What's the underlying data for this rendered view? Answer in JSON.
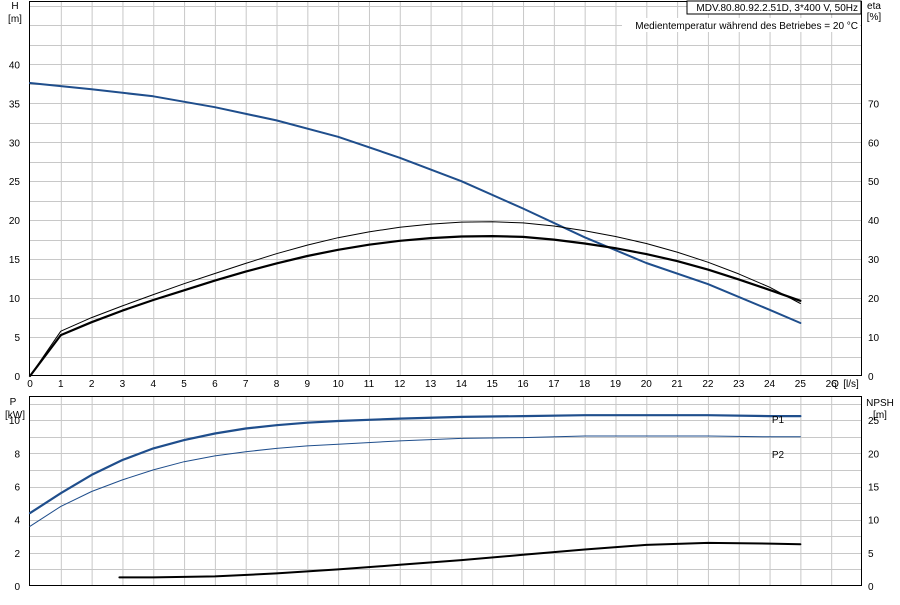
{
  "header": {
    "model": "MDV.80.80.92.2.51D, 3*400 V, 50Hz",
    "note": "Medientemperatur während des Betriebes = 20 °C"
  },
  "chart_data": [
    {
      "type": "line",
      "panel": "top",
      "x_axis": {
        "label": "Q",
        "unit": "[l/s]",
        "range": [
          0,
          27
        ],
        "ticks": [
          0,
          1,
          2,
          3,
          4,
          5,
          6,
          7,
          8,
          9,
          10,
          11,
          12,
          13,
          14,
          15,
          16,
          17,
          18,
          19,
          20,
          21,
          22,
          23,
          24,
          25,
          26
        ]
      },
      "y_left": {
        "label": "H",
        "unit": "[m]",
        "range": [
          0,
          48
        ],
        "ticks": [
          0,
          5,
          10,
          15,
          20,
          25,
          30,
          35,
          40
        ]
      },
      "y_right": {
        "label": "eta",
        "unit": "[%]",
        "range": [
          0,
          96
        ],
        "ticks": [
          0,
          10,
          20,
          30,
          40,
          50,
          60,
          70
        ]
      },
      "grid": true,
      "series": [
        {
          "axis": "left",
          "color": "#1f4e8c",
          "points": [
            [
              0,
              37.6
            ],
            [
              2,
              36.8
            ],
            [
              4,
              35.9
            ],
            [
              6,
              34.5
            ],
            [
              8,
              32.8
            ],
            [
              10,
              30.7
            ],
            [
              12,
              28.0
            ],
            [
              14,
              25.0
            ],
            [
              16,
              21.5
            ],
            [
              18,
              17.8
            ],
            [
              20,
              14.5
            ],
            [
              22,
              11.8
            ],
            [
              24,
              8.5
            ],
            [
              25,
              6.8
            ]
          ]
        },
        {
          "axis": "right",
          "color": "#000000",
          "points": [
            [
              0,
              0
            ],
            [
              1,
              10.5
            ],
            [
              2,
              13.8
            ],
            [
              3,
              16.8
            ],
            [
              4,
              19.5
            ],
            [
              5,
              22.0
            ],
            [
              6,
              24.5
            ],
            [
              7,
              26.8
            ],
            [
              8,
              28.9
            ],
            [
              9,
              30.8
            ],
            [
              10,
              32.4
            ],
            [
              11,
              33.7
            ],
            [
              12,
              34.7
            ],
            [
              13,
              35.4
            ],
            [
              14,
              35.8
            ],
            [
              15,
              35.9
            ],
            [
              16,
              35.7
            ],
            [
              17,
              35.0
            ],
            [
              18,
              34.0
            ],
            [
              19,
              32.8
            ],
            [
              20,
              31.3
            ],
            [
              21,
              29.5
            ],
            [
              22,
              27.3
            ],
            [
              23,
              24.8
            ],
            [
              24,
              22.1
            ],
            [
              25,
              19.3
            ]
          ]
        },
        {
          "axis": "right",
          "color": "#000000",
          "points": [
            [
              0,
              0
            ],
            [
              1,
              11.5
            ],
            [
              2,
              15.0
            ],
            [
              3,
              18.0
            ],
            [
              4,
              20.9
            ],
            [
              5,
              23.7
            ],
            [
              6,
              26.3
            ],
            [
              7,
              28.9
            ],
            [
              8,
              31.4
            ],
            [
              9,
              33.6
            ],
            [
              10,
              35.5
            ],
            [
              11,
              37.0
            ],
            [
              12,
              38.2
            ],
            [
              13,
              39.0
            ],
            [
              14,
              39.5
            ],
            [
              15,
              39.6
            ],
            [
              16,
              39.3
            ],
            [
              17,
              38.5
            ],
            [
              18,
              37.3
            ],
            [
              19,
              35.8
            ],
            [
              20,
              34.0
            ],
            [
              21,
              31.8
            ],
            [
              22,
              29.2
            ],
            [
              23,
              26.2
            ],
            [
              24,
              22.8
            ],
            [
              25,
              18.6
            ]
          ]
        }
      ]
    },
    {
      "type": "line",
      "panel": "bottom",
      "x_axis": {
        "range": [
          0,
          27
        ]
      },
      "y_left": {
        "label": "P",
        "unit": "[kW]",
        "range": [
          0,
          11.4
        ],
        "ticks": [
          0,
          2,
          4,
          6,
          8,
          10
        ]
      },
      "y_right": {
        "label": "NPSH",
        "unit": "[m]",
        "range": [
          0,
          28.5
        ],
        "ticks": [
          0,
          5,
          10,
          15,
          20,
          25
        ]
      },
      "grid": true,
      "series": [
        {
          "name": "P1",
          "axis": "left",
          "color": "#1f4e8c",
          "points": [
            [
              0,
              4.4
            ],
            [
              1,
              5.6
            ],
            [
              2,
              6.7
            ],
            [
              3,
              7.6
            ],
            [
              4,
              8.3
            ],
            [
              5,
              8.8
            ],
            [
              6,
              9.2
            ],
            [
              7,
              9.5
            ],
            [
              8,
              9.7
            ],
            [
              9,
              9.85
            ],
            [
              10,
              9.95
            ],
            [
              12,
              10.1
            ],
            [
              14,
              10.2
            ],
            [
              16,
              10.25
            ],
            [
              18,
              10.3
            ],
            [
              20,
              10.3
            ],
            [
              22,
              10.3
            ],
            [
              24,
              10.25
            ],
            [
              25,
              10.25
            ]
          ]
        },
        {
          "name": "P2",
          "axis": "left",
          "color": "#1f4e8c",
          "points": [
            [
              0,
              3.6
            ],
            [
              1,
              4.8
            ],
            [
              2,
              5.7
            ],
            [
              3,
              6.4
            ],
            [
              4,
              7.0
            ],
            [
              5,
              7.5
            ],
            [
              6,
              7.85
            ],
            [
              7,
              8.1
            ],
            [
              8,
              8.3
            ],
            [
              9,
              8.45
            ],
            [
              10,
              8.55
            ],
            [
              12,
              8.75
            ],
            [
              14,
              8.9
            ],
            [
              16,
              8.95
            ],
            [
              18,
              9.05
            ],
            [
              20,
              9.05
            ],
            [
              22,
              9.05
            ],
            [
              24,
              9.0
            ],
            [
              25,
              9.0
            ]
          ]
        },
        {
          "axis": "right",
          "color": "#000000",
          "points": [
            [
              2.9,
              1.3
            ],
            [
              4,
              1.3
            ],
            [
              6,
              1.45
            ],
            [
              8,
              1.9
            ],
            [
              10,
              2.5
            ],
            [
              12,
              3.2
            ],
            [
              14,
              3.9
            ],
            [
              16,
              4.7
            ],
            [
              18,
              5.5
            ],
            [
              20,
              6.2
            ],
            [
              22,
              6.5
            ],
            [
              24,
              6.4
            ],
            [
              25,
              6.3
            ]
          ]
        }
      ]
    }
  ]
}
